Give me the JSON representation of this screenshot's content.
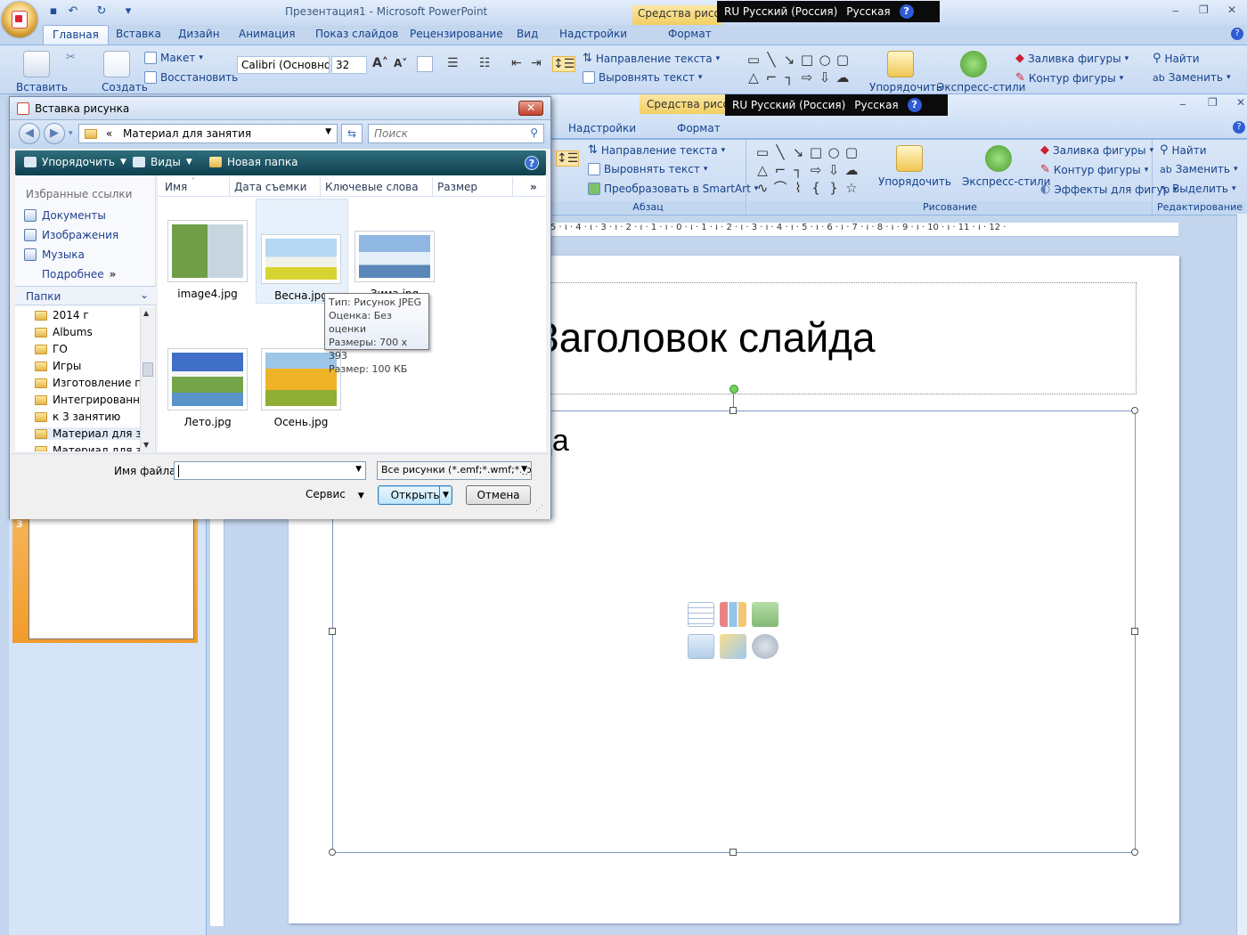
{
  "app": {
    "title": "Презентация1 - Microsoft PowerPoint",
    "context_tab": "Средства рисова",
    "lang": "RU Русский (Россия)",
    "keyboard": "Русская",
    "help": "?",
    "minimize": "‒",
    "maximize": "❐",
    "close": "✕"
  },
  "tabs": [
    "Главная",
    "Вставка",
    "Дизайн",
    "Анимация",
    "Показ слайдов",
    "Рецензирование",
    "Вид",
    "Надстройки",
    "Формат"
  ],
  "ribbon": {
    "paste": "Вставить",
    "create": "Создать",
    "layout": "Макет",
    "restore": "Восстановить",
    "font_name": "Calibri (Основно",
    "font_size": "32",
    "text_direction": "Направление текста",
    "align_text": "Выровнять текст",
    "convert_smartart": "Преобразовать в SmartArt",
    "arrange": "Упорядочить",
    "quick_styles": "Экспресс-стили",
    "shape_fill": "Заливка фигуры",
    "shape_outline": "Контур фигуры",
    "shape_effects": "Эффекты для фигур",
    "find": "Найти",
    "replace": "Заменить",
    "select": "Выделить",
    "group_paragraph": "Абзац",
    "group_drawing": "Рисование",
    "group_editing": "Редактирование"
  },
  "window2": {
    "tabs": [
      "Надстройки",
      "Формат"
    ],
    "context_tab": "Средства рисова"
  },
  "ruler": {
    "marks": "5 · ı · 4 · ı · 3 · ı · 2 · ı · 1 · ı · 0 · ı · 1 · ı · 2 · ı · 3 · ı · 4 · ı · 5 · ı · 6 · ı · 7 · ı · 8 · ı · 9 · ı · 10 · ı · 11 · ı · 12 ·"
  },
  "slide": {
    "number": "3",
    "title_text": "Заголовок слайда",
    "content_text": "да"
  },
  "dialog": {
    "title": "Вставка рисунка",
    "close": "✕",
    "address_prefix": "«",
    "address": "Материал для занятия",
    "search_placeholder": "Поиск",
    "toolbar": {
      "organize": "Упорядочить",
      "views": "Виды",
      "new_folder": "Новая папка",
      "help": "?"
    },
    "favorites_header": "Избранные ссылки",
    "favorites": [
      "Документы",
      "Изображения",
      "Музыка"
    ],
    "more": "Подробнее",
    "more_glyph": "»",
    "folders_header": "Папки",
    "folders": [
      "2014 г",
      "Albums",
      "ГО",
      "Игры",
      "Изготовление пре",
      "Интегрированны",
      "к 3 занятию",
      "Материал для зан",
      "Материал для зан"
    ],
    "columns": [
      "Имя",
      "Дата съемки",
      "Ключевые слова",
      "Размер"
    ],
    "columns_more": "»",
    "files": [
      {
        "name": "image4.jpg"
      },
      {
        "name": "Весна.jpg"
      },
      {
        "name": "Зима.jpg"
      },
      {
        "name": "Лето.jpg"
      },
      {
        "name": "Осень.jpg"
      }
    ],
    "tooltip": {
      "type": "Тип: Рисунок JPEG",
      "rating": "Оценка: Без оценки",
      "dimensions": "Размеры: 700 x 393",
      "size": "Размер: 100 КБ"
    },
    "filename_label": "Имя файла:",
    "filename_value": "",
    "filter": "Все рисунки (*.emf;*.wmf;*.jpg;",
    "service": "Сервис",
    "open": "Открыть",
    "cancel": "Отмена"
  }
}
